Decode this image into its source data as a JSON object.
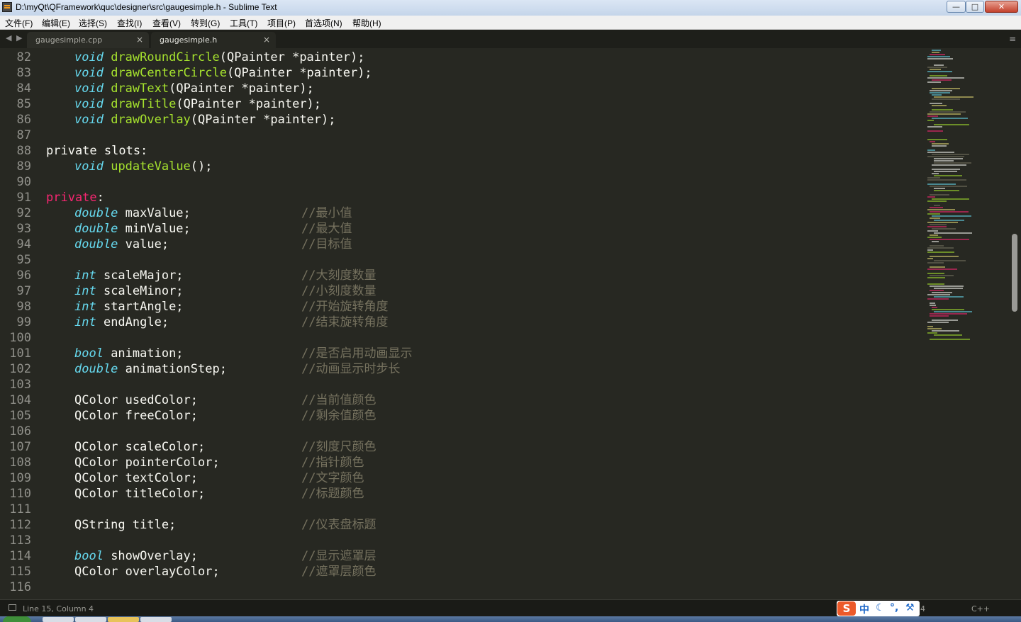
{
  "window": {
    "title": "D:\\myQt\\QFramework\\quc\\designer\\src\\gaugesimple.h - Sublime Text",
    "minimize": "—",
    "maximize": "□",
    "close": "✕"
  },
  "menu": [
    "文件(F)",
    "编辑(E)",
    "选择(S)",
    "查找(I)",
    "查看(V)",
    "转到(G)",
    "工具(T)",
    "项目(P)",
    "首选项(N)",
    "帮助(H)"
  ],
  "tabs": [
    {
      "label": "gaugesimple.cpp",
      "active": false
    },
    {
      "label": "gaugesimple.h",
      "active": true
    }
  ],
  "tab_nav": {
    "prev": "◀",
    "next": "▶",
    "menu": "≡",
    "close": "×"
  },
  "colors": {
    "background": "#272822",
    "type_keyword": "#66d9ef",
    "function": "#a6e22e",
    "access_keyword": "#f92672",
    "comment": "#75715e",
    "text": "#f8f8f2",
    "line_number": "#90908a"
  },
  "code_lines": [
    {
      "n": "82",
      "tokens": [
        [
          "t",
          "void"
        ],
        [
          "p",
          " "
        ],
        [
          "f",
          "drawRoundCircle"
        ],
        [
          "p",
          "(QPainter *painter);"
        ]
      ]
    },
    {
      "n": "83",
      "tokens": [
        [
          "t",
          "void"
        ],
        [
          "p",
          " "
        ],
        [
          "f",
          "drawCenterCircle"
        ],
        [
          "p",
          "(QPainter *painter);"
        ]
      ]
    },
    {
      "n": "84",
      "tokens": [
        [
          "t",
          "void"
        ],
        [
          "p",
          " "
        ],
        [
          "f",
          "drawText"
        ],
        [
          "p",
          "(QPainter *painter);"
        ]
      ]
    },
    {
      "n": "85",
      "tokens": [
        [
          "t",
          "void"
        ],
        [
          "p",
          " "
        ],
        [
          "f",
          "drawTitle"
        ],
        [
          "p",
          "(QPainter *painter);"
        ]
      ]
    },
    {
      "n": "86",
      "tokens": [
        [
          "t",
          "void"
        ],
        [
          "p",
          " "
        ],
        [
          "f",
          "drawOverlay"
        ],
        [
          "p",
          "(QPainter *painter);"
        ]
      ]
    },
    {
      "n": "87",
      "tokens": []
    },
    {
      "n": "88",
      "tokens": [
        [
          "p",
          "private slots:"
        ]
      ]
    },
    {
      "n": "89",
      "tokens": [
        [
          "t",
          "void"
        ],
        [
          "p",
          " "
        ],
        [
          "f",
          "updateValue"
        ],
        [
          "p",
          "();"
        ]
      ]
    },
    {
      "n": "90",
      "tokens": []
    },
    {
      "n": "91",
      "tokens": [
        [
          "a",
          "private"
        ],
        [
          "p",
          ":"
        ]
      ]
    },
    {
      "n": "92",
      "tokens": [
        [
          "t",
          "double"
        ],
        [
          "p",
          " maxValue;"
        ],
        [
          "c",
          "//最小值"
        ]
      ]
    },
    {
      "n": "93",
      "tokens": [
        [
          "t",
          "double"
        ],
        [
          "p",
          " minValue;"
        ],
        [
          "c",
          "//最大值"
        ]
      ]
    },
    {
      "n": "94",
      "tokens": [
        [
          "t",
          "double"
        ],
        [
          "p",
          " value;"
        ],
        [
          "c",
          "//目标值"
        ]
      ]
    },
    {
      "n": "95",
      "tokens": []
    },
    {
      "n": "96",
      "tokens": [
        [
          "t",
          "int"
        ],
        [
          "p",
          " scaleMajor;"
        ],
        [
          "c",
          "//大刻度数量"
        ]
      ]
    },
    {
      "n": "97",
      "tokens": [
        [
          "t",
          "int"
        ],
        [
          "p",
          " scaleMinor;"
        ],
        [
          "c",
          "//小刻度数量"
        ]
      ]
    },
    {
      "n": "98",
      "tokens": [
        [
          "t",
          "int"
        ],
        [
          "p",
          " startAngle;"
        ],
        [
          "c",
          "//开始旋转角度"
        ]
      ]
    },
    {
      "n": "99",
      "tokens": [
        [
          "t",
          "int"
        ],
        [
          "p",
          " endAngle;"
        ],
        [
          "c",
          "//结束旋转角度"
        ]
      ]
    },
    {
      "n": "100",
      "tokens": []
    },
    {
      "n": "101",
      "tokens": [
        [
          "t",
          "bool"
        ],
        [
          "p",
          " animation;"
        ],
        [
          "c",
          "//是否启用动画显示"
        ]
      ]
    },
    {
      "n": "102",
      "tokens": [
        [
          "t",
          "double"
        ],
        [
          "p",
          " animationStep;"
        ],
        [
          "c",
          "//动画显示时步长"
        ]
      ]
    },
    {
      "n": "103",
      "tokens": []
    },
    {
      "n": "104",
      "tokens": [
        [
          "p",
          "QColor usedColor;"
        ],
        [
          "c",
          "//当前值颜色"
        ]
      ]
    },
    {
      "n": "105",
      "tokens": [
        [
          "p",
          "QColor freeColor;"
        ],
        [
          "c",
          "//剩余值颜色"
        ]
      ]
    },
    {
      "n": "106",
      "tokens": []
    },
    {
      "n": "107",
      "tokens": [
        [
          "p",
          "QColor scaleColor;"
        ],
        [
          "c",
          "//刻度尺颜色"
        ]
      ]
    },
    {
      "n": "108",
      "tokens": [
        [
          "p",
          "QColor pointerColor;"
        ],
        [
          "c",
          "//指针颜色"
        ]
      ]
    },
    {
      "n": "109",
      "tokens": [
        [
          "p",
          "QColor textColor;"
        ],
        [
          "c",
          "//文字颜色"
        ]
      ]
    },
    {
      "n": "110",
      "tokens": [
        [
          "p",
          "QColor titleColor;"
        ],
        [
          "c",
          "//标题颜色"
        ]
      ]
    },
    {
      "n": "111",
      "tokens": []
    },
    {
      "n": "112",
      "tokens": [
        [
          "p",
          "QString title;"
        ],
        [
          "c",
          "//仪表盘标题"
        ]
      ]
    },
    {
      "n": "113",
      "tokens": []
    },
    {
      "n": "114",
      "tokens": [
        [
          "t",
          "bool"
        ],
        [
          "p",
          " showOverlay;"
        ],
        [
          "c",
          "//显示遮罩层"
        ]
      ]
    },
    {
      "n": "115",
      "tokens": [
        [
          "p",
          "QColor overlayColor;"
        ],
        [
          "c",
          "//遮罩层颜色"
        ]
      ]
    },
    {
      "n": "116",
      "tokens": []
    }
  ],
  "status": {
    "position": "Line 15, Column 4",
    "syntax": "C++",
    "ime_logo": "S",
    "ime_lang": "中",
    "ime_moon": "☾",
    "ime_punct": "°,",
    "ime_tool": "⚒",
    "ime_tail": "4"
  }
}
